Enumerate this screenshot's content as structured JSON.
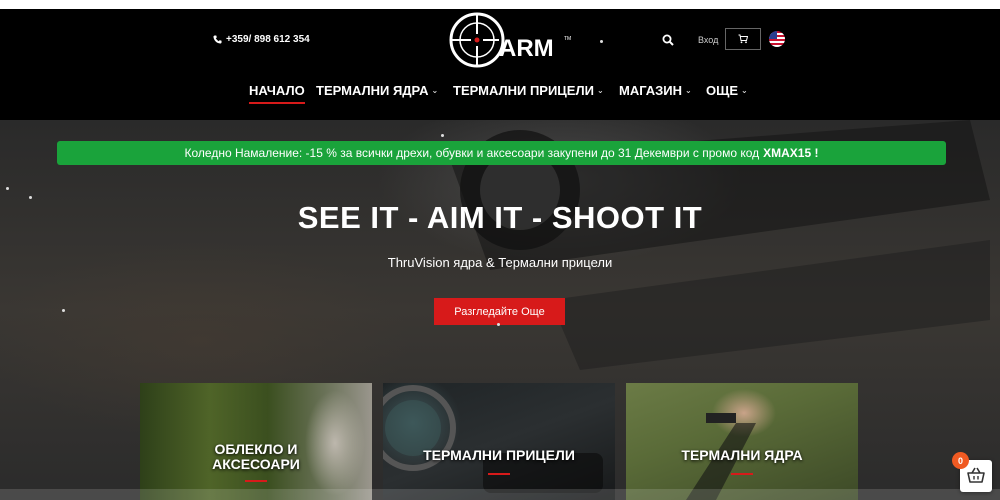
{
  "header": {
    "phone": "+359/ 898 612 354",
    "login_label": "Вход",
    "logo_text": "ARM",
    "logo_tm": "TM",
    "icons": {
      "phone": "phone-icon",
      "search": "search-icon",
      "cart": "cart-icon",
      "flag": "us-flag-icon"
    }
  },
  "nav": {
    "items": [
      {
        "label": "НАЧАЛО",
        "active": true
      },
      {
        "label": "ТЕРМАЛНИ ЯДРА",
        "chevron": "⌄"
      },
      {
        "label": "ТЕРМАЛНИ ПРИЦЕЛИ",
        "chevron": "⌄"
      },
      {
        "label": "МАГАЗИН",
        "chevron": "⌄"
      },
      {
        "label": "ОЩЕ",
        "chevron": "⌄"
      }
    ]
  },
  "promo": {
    "text": "Коледно Намаление: -15 % за всички дрехи, обувки и аксесоари закупени до 31 Декември с промо код",
    "code": "XMAX15 !",
    "color": "#1aa33b"
  },
  "hero": {
    "headline": "SEE IT - AIM IT - SHOOT IT",
    "subline": "ThruVision ядра & Термални прицели",
    "cta_label": "Разгледайте Още"
  },
  "cards": [
    {
      "line1": "ОБЛЕКЛО И",
      "line2": "АКСЕСОАРИ"
    },
    {
      "line1": "ТЕРМАЛНИ ПРИЦЕЛИ",
      "line2": ""
    },
    {
      "line1": "ТЕРМАЛНИ ЯДРА",
      "line2": ""
    }
  ],
  "floating_cart": {
    "count": "0",
    "icon": "basket-icon"
  },
  "colors": {
    "accent": "#d71a1a",
    "promo_green": "#1aa33b",
    "badge_orange": "#f05a22"
  }
}
